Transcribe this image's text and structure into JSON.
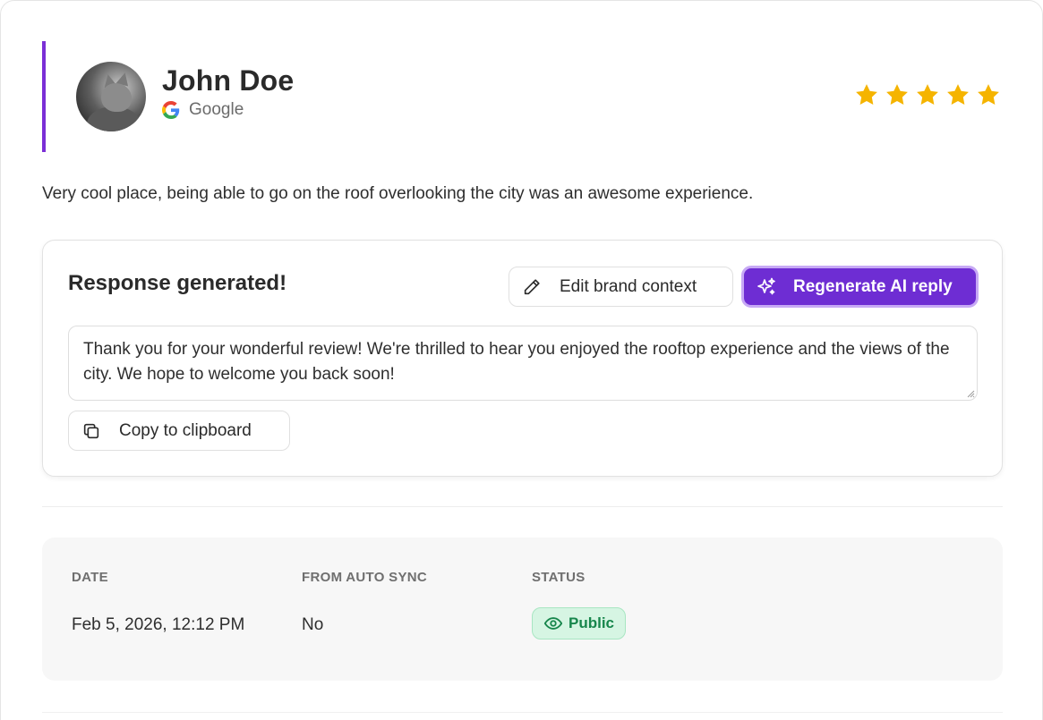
{
  "review": {
    "reviewer_name": "John Doe",
    "source": "Google",
    "rating": 5,
    "text": "Very cool place, being able to go on the roof overlooking the city was an awesome experience."
  },
  "response": {
    "title": "Response generated!",
    "edit_label": "Edit brand context",
    "regenerate_label": "Regenerate AI reply",
    "reply_text": "Thank you for your wonderful review! We're thrilled to hear you enjoyed the rooftop experience and the views of the city. We hope to welcome you back soon!",
    "copy_label": "Copy to clipboard"
  },
  "meta": {
    "date_header": "DATE",
    "date_value": "Feb 5, 2026, 12:12 PM",
    "sync_header": "FROM AUTO SYNC",
    "sync_value": "No",
    "status_header": "STATUS",
    "status_value": "Public"
  },
  "colors": {
    "accent": "#6e2dd3",
    "accent_border": "#7b2fd6",
    "star": "#f5b400",
    "status_bg": "#d6f5e3",
    "status_text": "#17864c"
  },
  "icons": {
    "source": "google-icon",
    "edit": "pencil-icon",
    "regenerate": "sparkles-icon",
    "copy": "copy-icon",
    "status": "eye-icon"
  }
}
